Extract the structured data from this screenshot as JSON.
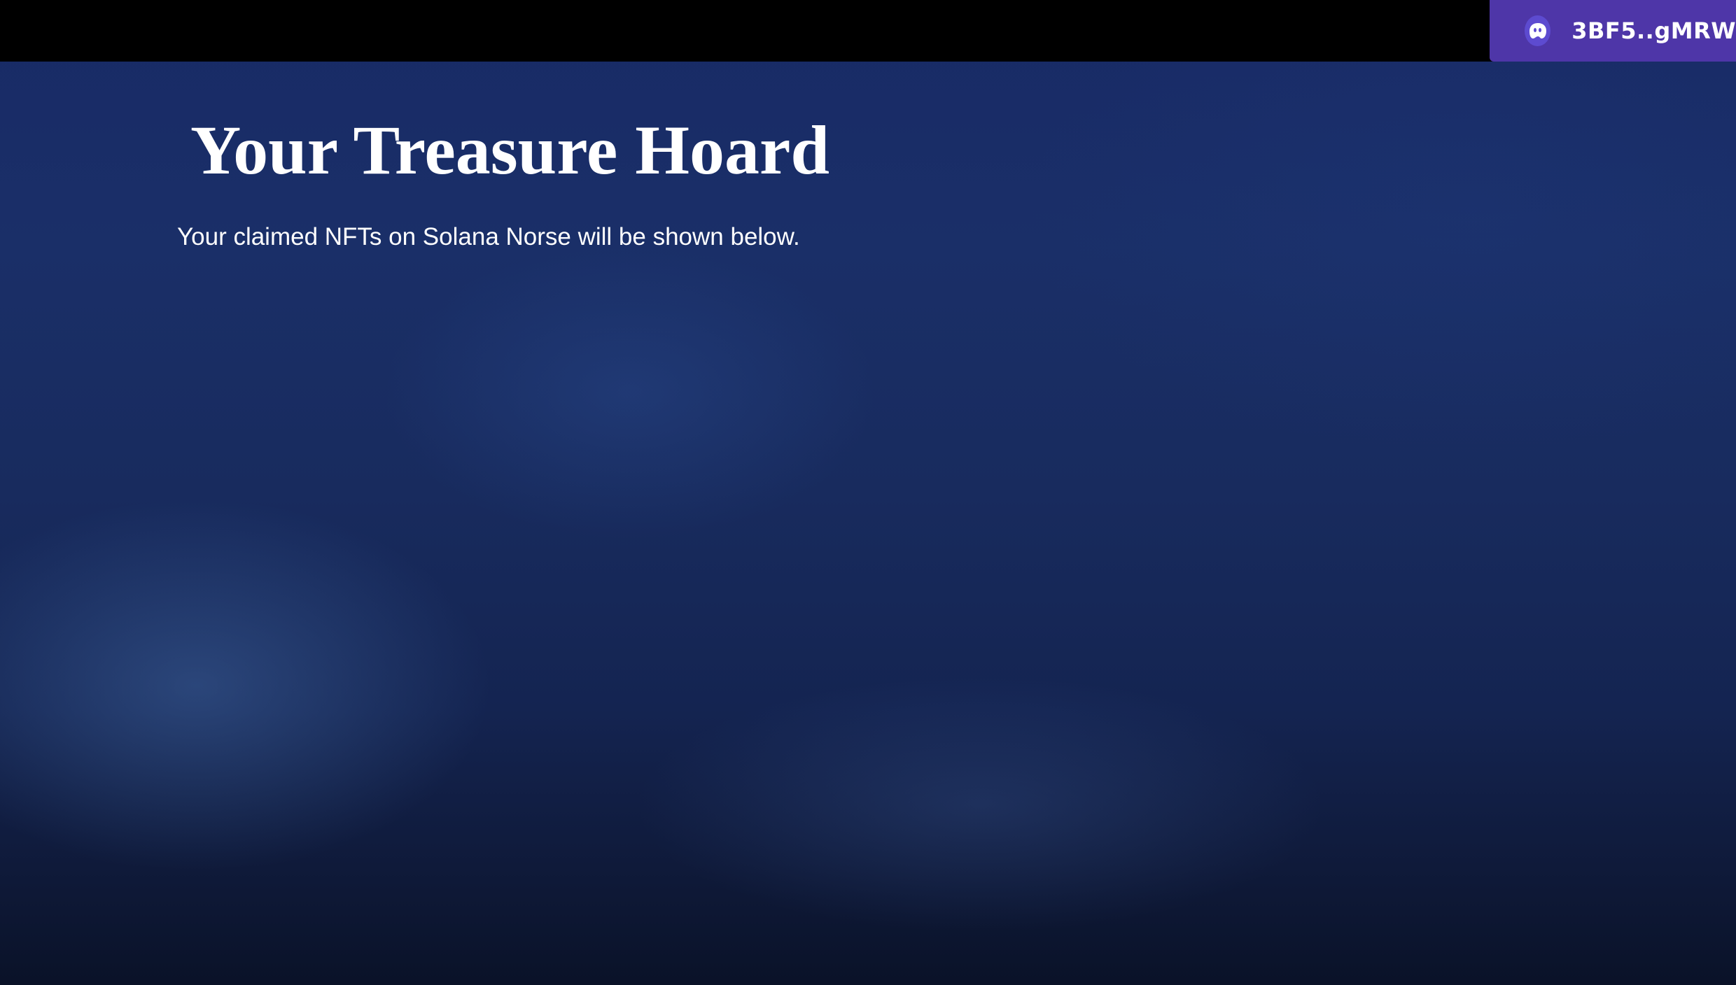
{
  "wallet": {
    "address": "3BF5..gMRW",
    "icon": "phantom-ghost-icon"
  },
  "main": {
    "title": "Your Treasure Hoard",
    "subtitle": "Your claimed NFTs on Solana Norse will be shown below.",
    "nfts": []
  },
  "colors": {
    "topbar": "#000000",
    "wallet_button": "#4e36a8",
    "background": "#182a66",
    "text": "#ffffff"
  }
}
